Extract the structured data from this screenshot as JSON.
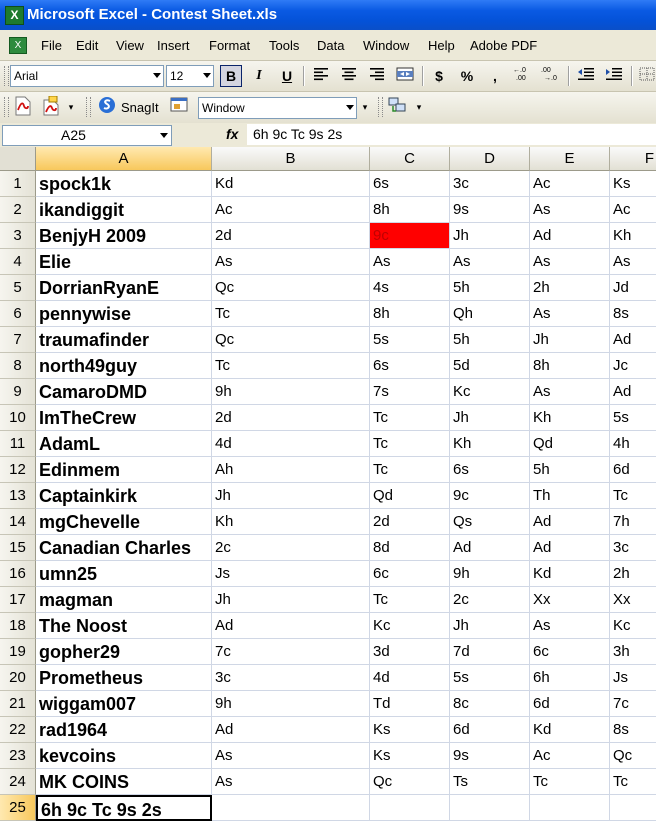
{
  "window": {
    "title": "Microsoft Excel - Contest Sheet.xls"
  },
  "menu": [
    "File",
    "Edit",
    "View",
    "Insert",
    "Format",
    "Tools",
    "Data",
    "Window",
    "Help",
    "Adobe PDF"
  ],
  "toolbar": {
    "font_name": "Arial",
    "font_size": "12",
    "bold_label": "B",
    "italic_label": "I",
    "underline_label": "U",
    "currency_label": "$",
    "percent_label": "%",
    "comma_label": ",",
    "snagit_label": "SnagIt",
    "window_combo": "Window"
  },
  "formula_bar": {
    "name_box": "A25",
    "fx_label": "fx",
    "content": "6h 9c Tc 9s 2s"
  },
  "columns": [
    "A",
    "B",
    "C",
    "D",
    "E",
    "F"
  ],
  "rows": [
    {
      "n": "1",
      "a": "spock1k",
      "b": "Kd",
      "c": "6s",
      "d": "3c",
      "e": "Ac",
      "f": "Ks"
    },
    {
      "n": "2",
      "a": "ikandiggit",
      "b": "Ac",
      "c": "8h",
      "d": "9s",
      "e": "As",
      "f": "Ac"
    },
    {
      "n": "3",
      "a": "BenjyH 2009",
      "b": "2d",
      "c": "9c",
      "d": "Jh",
      "e": "Ad",
      "f": "Kh"
    },
    {
      "n": "4",
      "a": "Elie",
      "b": "As",
      "c": "As",
      "d": "As",
      "e": "As",
      "f": "As"
    },
    {
      "n": "5",
      "a": "DorrianRyanE",
      "b": "Qc",
      "c": "4s",
      "d": "5h",
      "e": "2h",
      "f": "Jd"
    },
    {
      "n": "6",
      "a": "pennywise",
      "b": "Tc",
      "c": "8h",
      "d": "Qh",
      "e": "As",
      "f": "8s"
    },
    {
      "n": "7",
      "a": "traumafinder",
      "b": "Qc",
      "c": "5s",
      "d": "5h",
      "e": "Jh",
      "f": "Ad"
    },
    {
      "n": "8",
      "a": "north49guy",
      "b": "Tc",
      "c": "6s",
      "d": "5d",
      "e": "8h",
      "f": "Jc"
    },
    {
      "n": "9",
      "a": "CamaroDMD",
      "b": "9h",
      "c": "7s",
      "d": "Kc",
      "e": "As",
      "f": "Ad"
    },
    {
      "n": "10",
      "a": "ImTheCrew",
      "b": "2d",
      "c": "Tc",
      "d": "Jh",
      "e": "Kh",
      "f": "5s"
    },
    {
      "n": "11",
      "a": "AdamL",
      "b": "4d",
      "c": "Tc",
      "d": "Kh",
      "e": "Qd",
      "f": "4h"
    },
    {
      "n": "12",
      "a": "Edinmem",
      "b": "Ah",
      "c": "Tc",
      "d": "6s",
      "e": "5h",
      "f": "6d"
    },
    {
      "n": "13",
      "a": "Captainkirk",
      "b": "Jh",
      "c": "Qd",
      "d": "9c",
      "e": "Th",
      "f": "Tc"
    },
    {
      "n": "14",
      "a": "mgChevelle",
      "b": "Kh",
      "c": "2d",
      "d": "Qs",
      "e": "Ad",
      "f": "7h"
    },
    {
      "n": "15",
      "a": "Canadian Charles",
      "b": "2c",
      "c": "8d",
      "d": "Ad",
      "e": "Ad",
      "f": "3c"
    },
    {
      "n": "16",
      "a": "umn25",
      "b": "Js",
      "c": "6c",
      "d": "9h",
      "e": "Kd",
      "f": "2h"
    },
    {
      "n": "17",
      "a": "magman",
      "b": "Jh",
      "c": "Tc",
      "d": "2c",
      "e": "Xx",
      "f": "Xx"
    },
    {
      "n": "18",
      "a": "The Noost",
      "b": "Ad",
      "c": "Kc",
      "d": "Jh",
      "e": "As",
      "f": "Kc"
    },
    {
      "n": "19",
      "a": "gopher29",
      "b": "7c",
      "c": "3d",
      "d": "7d",
      "e": "6c",
      "f": "3h"
    },
    {
      "n": "20",
      "a": "Prometheus",
      "b": "3c",
      "c": "4d",
      "d": "5s",
      "e": "6h",
      "f": "Js"
    },
    {
      "n": "21",
      "a": "wiggam007",
      "b": "9h",
      "c": "Td",
      "d": "8c",
      "e": "6d",
      "f": "7c"
    },
    {
      "n": "22",
      "a": "rad1964",
      "b": "Ad",
      "c": "Ks",
      "d": "6d",
      "e": "Kd",
      "f": "8s"
    },
    {
      "n": "23",
      "a": "kevcoins",
      "b": "As",
      "c": "Ks",
      "d": "9s",
      "e": "Ac",
      "f": "Qc"
    },
    {
      "n": "24",
      "a": "MK COINS",
      "b": "As",
      "c": "Qc",
      "d": "Ts",
      "e": "Tc",
      "f": "Tc"
    },
    {
      "n": "25",
      "a": "6h 9c Tc 9s 2s",
      "b": "",
      "c": "",
      "d": "",
      "e": "",
      "f": ""
    }
  ],
  "highlight": {
    "row": 3,
    "col": "c",
    "color": "#ff0000"
  },
  "active_cell": {
    "row": 25,
    "col": "a"
  },
  "colors": {
    "title_bar": "#0a5ae3",
    "chrome": "#ece9d8",
    "header_selected": "#f8c85c",
    "gridline": "#d0d7e5"
  }
}
